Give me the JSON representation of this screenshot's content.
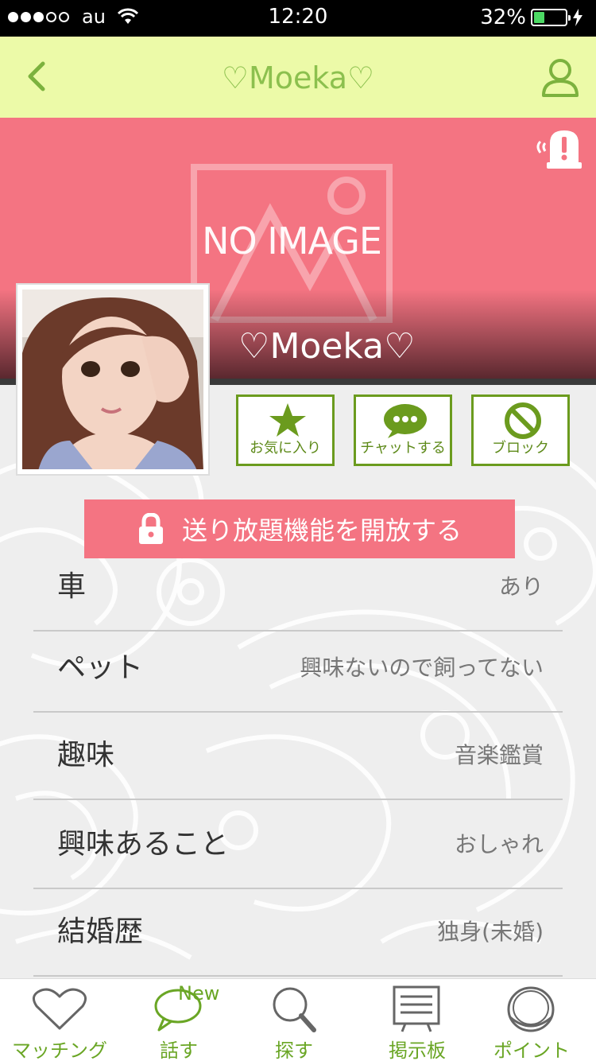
{
  "status_bar": {
    "carrier": "au",
    "time": "12:20",
    "battery": "32%"
  },
  "nav": {
    "title": "♡Moeka♡"
  },
  "hero": {
    "placeholder_text": "NO IMAGE",
    "name": "♡Moeka♡"
  },
  "actions": {
    "favorite_label": "お気に入り",
    "chat_label": "チャットする",
    "block_label": "ブロック"
  },
  "unlock": {
    "label": "送り放題機能を開放する"
  },
  "profile": {
    "rows": [
      {
        "key": "車",
        "value": "あり"
      },
      {
        "key": "ペット",
        "value": "興味ないので飼ってない"
      },
      {
        "key": "趣味",
        "value": "音楽鑑賞"
      },
      {
        "key": "興味あること",
        "value": "おしゃれ"
      },
      {
        "key": "結婚歴",
        "value": "独身(未婚)"
      }
    ]
  },
  "tab_bar": {
    "tabs": [
      {
        "label": "マッチング",
        "icon": "heart-icon"
      },
      {
        "label": "話す",
        "icon": "speech-bubble-icon",
        "badge": "New"
      },
      {
        "label": "探す",
        "icon": "magnifier-icon"
      },
      {
        "label": "掲示板",
        "icon": "board-icon"
      },
      {
        "label": "ポイント",
        "icon": "coin-icon"
      }
    ]
  },
  "colors": {
    "accent_green": "#6b9b1e",
    "nav_bg": "#ecfaa8",
    "hero_pink": "#f47482"
  }
}
